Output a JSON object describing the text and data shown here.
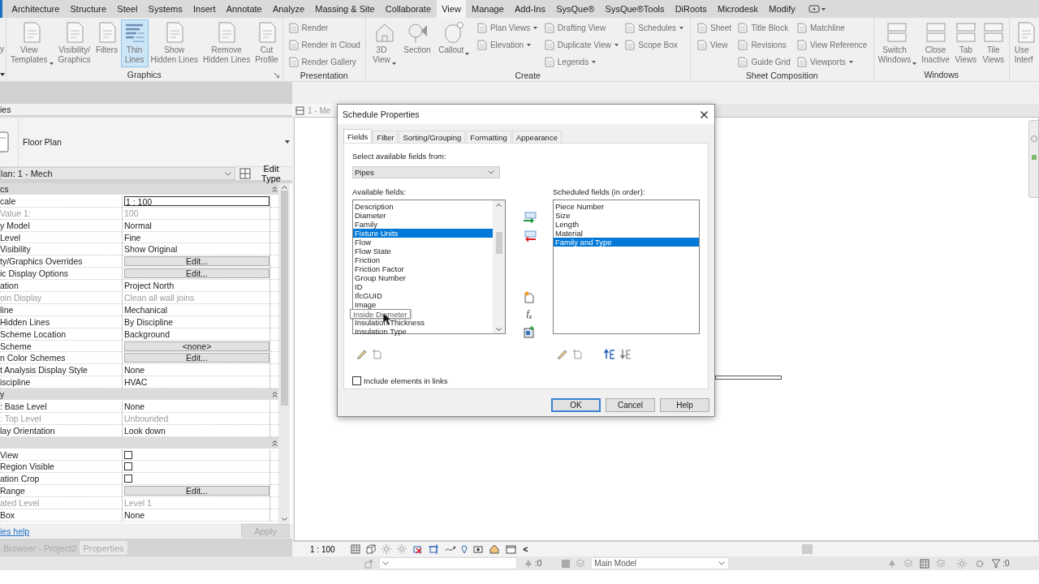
{
  "ribbon": {
    "tabs": [
      {
        "label": "Architecture",
        "selected": false
      },
      {
        "label": "Structure",
        "selected": false
      },
      {
        "label": "Steel",
        "selected": false
      },
      {
        "label": "Systems",
        "selected": false
      },
      {
        "label": "Insert",
        "selected": false
      },
      {
        "label": "Annotate",
        "selected": false
      },
      {
        "label": "Analyze",
        "selected": false
      },
      {
        "label": "Massing & Site",
        "selected": false
      },
      {
        "label": "Collaborate",
        "selected": false
      },
      {
        "label": "View",
        "selected": true
      },
      {
        "label": "Manage",
        "selected": false
      },
      {
        "label": "Add-Ins",
        "selected": false
      },
      {
        "label": "SysQue®",
        "selected": false
      },
      {
        "label": "SysQue®Tools",
        "selected": false
      },
      {
        "label": "DiRoots",
        "selected": false
      },
      {
        "label": "Microdesk",
        "selected": false
      },
      {
        "label": "Modify",
        "selected": false
      }
    ],
    "left_stub": "y",
    "panels": [
      {
        "title": "Graphics",
        "launcher": true,
        "large": [
          {
            "label": "View\nTemplates",
            "selected": false,
            "menu": true
          },
          {
            "label": "Visibility/\nGraphics",
            "selected": false,
            "menu": false
          },
          {
            "label": "Filters",
            "selected": false,
            "menu": false
          },
          {
            "label": "Thin\nLines",
            "selected": true,
            "menu": false
          },
          {
            "label": "Show\nHidden Lines",
            "selected": false,
            "menu": false
          },
          {
            "label": "Remove\nHidden Lines",
            "selected": false,
            "menu": false
          },
          {
            "label": "Cut\nProfile",
            "selected": false,
            "menu": false
          }
        ]
      },
      {
        "title": "Presentation",
        "launcher": false,
        "columns": [
          [
            {
              "label": "Render",
              "menu": false
            },
            {
              "label": "Render in Cloud",
              "menu": false
            },
            {
              "label": "Render Gallery",
              "menu": false
            }
          ]
        ]
      },
      {
        "title": "Create",
        "launcher": false,
        "large": [
          {
            "label": "3D\nView",
            "selected": false,
            "menu": true
          },
          {
            "label": "Section",
            "selected": false,
            "menu": false
          },
          {
            "label": "Callout",
            "selected": false,
            "menu": true
          }
        ],
        "columns": [
          [
            {
              "label": "Plan Views",
              "menu": true
            },
            {
              "label": "Elevation",
              "menu": true
            }
          ],
          [
            {
              "label": "Drafting View",
              "menu": false
            },
            {
              "label": "Duplicate View",
              "menu": true
            },
            {
              "label": "Legends",
              "menu": true
            }
          ],
          [
            {
              "label": "Schedules",
              "menu": true
            },
            {
              "label": "Scope Box",
              "menu": false
            }
          ]
        ]
      },
      {
        "title": "Sheet Composition",
        "launcher": false,
        "columns": [
          [
            {
              "label": "Sheet",
              "menu": false
            },
            {
              "label": "View",
              "menu": false
            }
          ],
          [
            {
              "label": "Title Block",
              "menu": false
            },
            {
              "label": "Revisions",
              "menu": false
            },
            {
              "label": "Guide Grid",
              "menu": false
            }
          ],
          [
            {
              "label": "Matchline",
              "menu": false
            },
            {
              "label": "View Reference",
              "menu": false
            },
            {
              "label": "Viewports",
              "menu": true
            }
          ]
        ]
      },
      {
        "title": "Windows",
        "launcher": false,
        "large": [
          {
            "label": "Switch\nWindows",
            "selected": false,
            "menu": true
          },
          {
            "label": "Close\nInactive",
            "selected": false,
            "menu": false
          },
          {
            "label": "Tab\nViews",
            "selected": false,
            "menu": false
          },
          {
            "label": "Tile\nViews",
            "selected": false,
            "menu": false
          }
        ]
      }
    ],
    "cut_button": "Use\nInterf"
  },
  "properties": {
    "title": "ies",
    "type_name": "Floor Plan",
    "instance": "lan: 1 - Mech",
    "edit_type": "Edit Type",
    "rows": [
      {
        "kind": "group",
        "label": "cs"
      },
      {
        "kind": "input",
        "label": "cale",
        "value": "1 : 100",
        "disabled": false
      },
      {
        "kind": "text",
        "label": "Value    1:",
        "value": "100",
        "disabled": true
      },
      {
        "kind": "text",
        "label": "y Model",
        "value": "Normal",
        "disabled": false
      },
      {
        "kind": "text",
        "label": "Level",
        "value": "Fine",
        "disabled": false
      },
      {
        "kind": "text",
        "label": "Visibility",
        "value": "Show Original",
        "disabled": false
      },
      {
        "kind": "button",
        "label": "ty/Graphics Overrides",
        "value": "Edit...",
        "disabled": false
      },
      {
        "kind": "button",
        "label": "ic Display Options",
        "value": "Edit...",
        "disabled": false
      },
      {
        "kind": "text",
        "label": "ation",
        "value": "Project North",
        "disabled": false
      },
      {
        "kind": "text",
        "label": "oin Display",
        "value": "Clean all wall joins",
        "disabled": true
      },
      {
        "kind": "text",
        "label": "line",
        "value": "Mechanical",
        "disabled": false
      },
      {
        "kind": "text",
        "label": "Hidden Lines",
        "value": "By Discipline",
        "disabled": false
      },
      {
        "kind": "text",
        "label": "Scheme Location",
        "value": "Background",
        "disabled": false
      },
      {
        "kind": "button",
        "label": "Scheme",
        "value": "<none>",
        "disabled": false
      },
      {
        "kind": "button",
        "label": "n Color Schemes",
        "value": "Edit...",
        "disabled": false
      },
      {
        "kind": "text",
        "label": "t Analysis Display Style",
        "value": "None",
        "disabled": false
      },
      {
        "kind": "text",
        "label": "iscipline",
        "value": "HVAC",
        "disabled": false
      },
      {
        "kind": "group",
        "label": "y"
      },
      {
        "kind": "text",
        "label": ": Base Level",
        "value": "None",
        "disabled": false
      },
      {
        "kind": "text",
        "label": ": Top Level",
        "value": "Unbounded",
        "disabled": true
      },
      {
        "kind": "text",
        "label": "lay Orientation",
        "value": "Look down",
        "disabled": false
      },
      {
        "kind": "group"
      },
      {
        "kind": "check",
        "label": "View",
        "checked": false,
        "disabled": false
      },
      {
        "kind": "check",
        "label": "Region Visible",
        "checked": false,
        "disabled": false
      },
      {
        "kind": "check",
        "label": "ation Crop",
        "checked": false,
        "disabled": false
      },
      {
        "kind": "button",
        "label": "Range",
        "value": "Edit...",
        "disabled": false
      },
      {
        "kind": "text",
        "label": "ated Level",
        "value": "Level 1",
        "disabled": true
      },
      {
        "kind": "text",
        "label": "Box",
        "value": "None",
        "disabled": false
      }
    ],
    "help_link": "ies help",
    "apply": {
      "label": "Apply",
      "disabled": true
    }
  },
  "bottom_tabs": [
    {
      "label": "Browser - Project2",
      "selected": false
    },
    {
      "label": "Properties",
      "selected": true
    }
  ],
  "view": {
    "tab": "1 - Me",
    "scale": "1 : 100",
    "collapse": "<"
  },
  "status": {
    "pick_count": ":0",
    "model": "Main Model",
    "filter_count": ":0"
  },
  "dialog": {
    "title": "Schedule Properties",
    "tabs": [
      {
        "label": "Fields",
        "selected": true
      },
      {
        "label": "Filter",
        "selected": false
      },
      {
        "label": "Sorting/Grouping",
        "selected": false
      },
      {
        "label": "Formatting",
        "selected": false
      },
      {
        "label": "Appearance",
        "selected": false
      }
    ],
    "source_label": "Select available fields from:",
    "source": "Pipes",
    "available_label": "Available fields:",
    "available": [
      {
        "kind": "item",
        "label": "Description",
        "selected": false
      },
      {
        "kind": "item",
        "label": "Diameter",
        "selected": false
      },
      {
        "kind": "item",
        "label": "Family",
        "selected": false
      },
      {
        "kind": "item",
        "label": "Fixture Units",
        "selected": true
      },
      {
        "kind": "item",
        "label": "Flow",
        "selected": false
      },
      {
        "kind": "item",
        "label": "Flow State",
        "selected": false
      },
      {
        "kind": "item",
        "label": "Friction",
        "selected": false
      },
      {
        "kind": "item",
        "label": "Friction Factor",
        "selected": false
      },
      {
        "kind": "item",
        "label": "Group Number",
        "selected": false
      },
      {
        "kind": "item",
        "label": "ID",
        "selected": false
      },
      {
        "kind": "item",
        "label": "IfcGUID",
        "selected": false
      },
      {
        "kind": "item",
        "label": "Image",
        "selected": false
      },
      {
        "kind": "tooltip",
        "label": "Inside Diameter"
      },
      {
        "kind": "item",
        "label": "Insulation Thickness",
        "selected": false
      },
      {
        "kind": "item",
        "label": "Insulation Type",
        "selected": false
      }
    ],
    "formula": "f$_{x}$",
    "scheduled_label": "Scheduled fields (in order):",
    "scheduled": [
      {
        "label": "Piece Number",
        "selected": false
      },
      {
        "label": "Size",
        "selected": false
      },
      {
        "label": "Length",
        "selected": false
      },
      {
        "label": "Material",
        "selected": false
      },
      {
        "label": "Family and Type",
        "selected": true
      }
    ],
    "include_links": {
      "label": "Include elements in links",
      "checked": false
    },
    "buttons": [
      {
        "label": "OK",
        "kind": "default"
      },
      {
        "label": "Cancel",
        "kind": "normal"
      },
      {
        "label": "Help",
        "kind": "normal"
      }
    ]
  }
}
